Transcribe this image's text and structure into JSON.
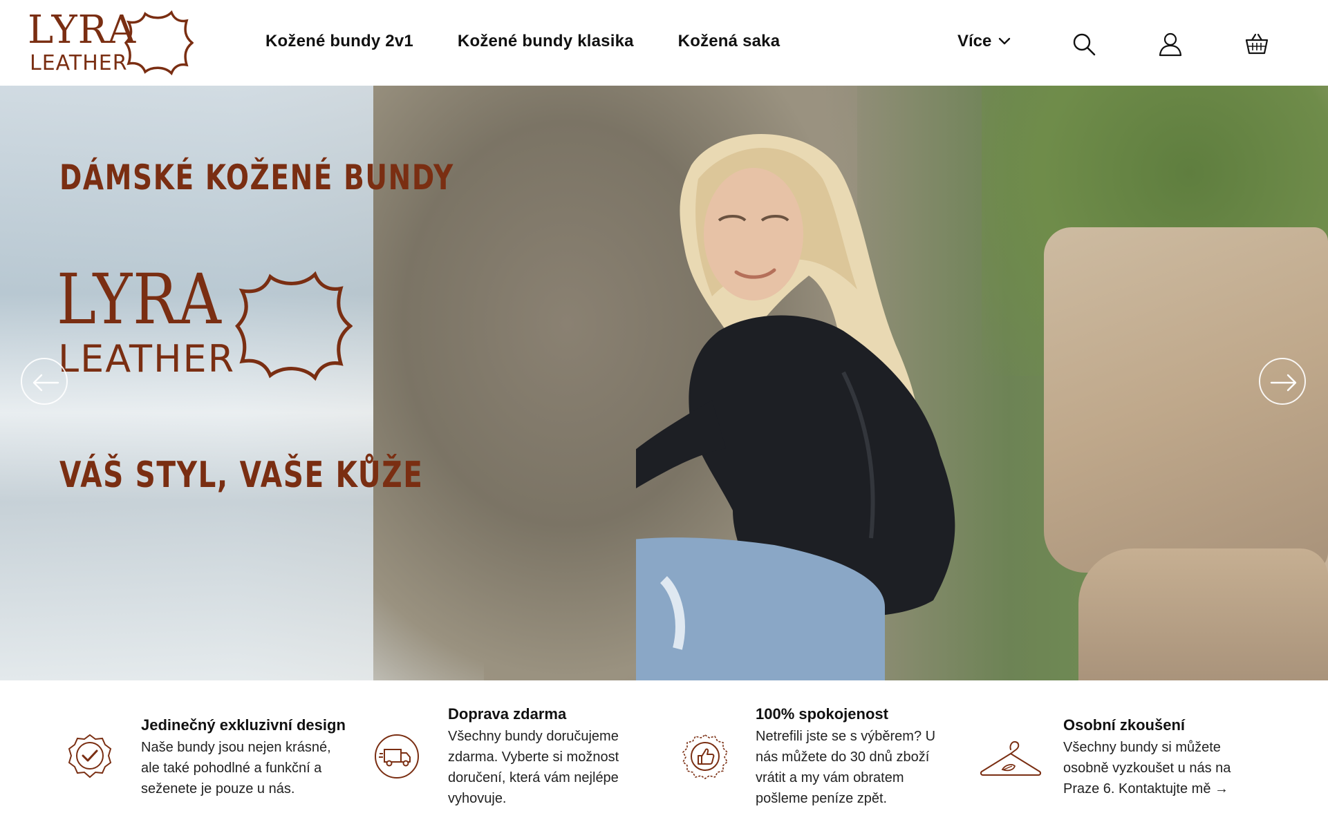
{
  "brand": {
    "line1": "LYRA",
    "line2": "LEATHER"
  },
  "nav": {
    "items": [
      {
        "label": "Kožené bundy 2v1"
      },
      {
        "label": "Kožené bundy klasika"
      },
      {
        "label": "Kožená saka"
      }
    ],
    "more_label": "Více"
  },
  "icons": [
    "search-icon",
    "user-icon",
    "cart-icon",
    "arrow-left-icon",
    "arrow-right-icon",
    "badge-check-icon",
    "truck-icon",
    "thumbs-up-icon",
    "hanger-icon"
  ],
  "colors": {
    "brand": "#7a2e12",
    "text": "#111111"
  },
  "hero": {
    "title": "DÁMSKÉ KOŽENÉ BUNDY",
    "logo_line1": "LYRA",
    "logo_line2": "LEATHER",
    "tagline": "VÁŠ STYL, VAŠE KŮŽE"
  },
  "features": [
    {
      "title": "Jedinečný exkluzivní design",
      "lines": [
        "Naše bundy jsou nejen krásné,",
        "ale také pohodlné a funkční a",
        "seženete je pouze u nás."
      ]
    },
    {
      "title": "Doprava zdarma",
      "lines": [
        "Všechny bundy doručujeme",
        "zdarma. Vyberte si možnost",
        "doručení, která vám nejlépe",
        "vyhovuje."
      ]
    },
    {
      "title": "100% spokojenost",
      "lines": [
        "Netrefili jste se s výběrem? U",
        "nás můžete do 30 dnů zboží",
        "vrátit a my vám obratem",
        "pošleme peníze zpět."
      ]
    },
    {
      "title": "Osobní zkoušení",
      "lines": [
        "Všechny bundy si můžete",
        "osobně vyzkoušet u nás na",
        "Praze 6. Kontaktujte mě →"
      ]
    }
  ]
}
